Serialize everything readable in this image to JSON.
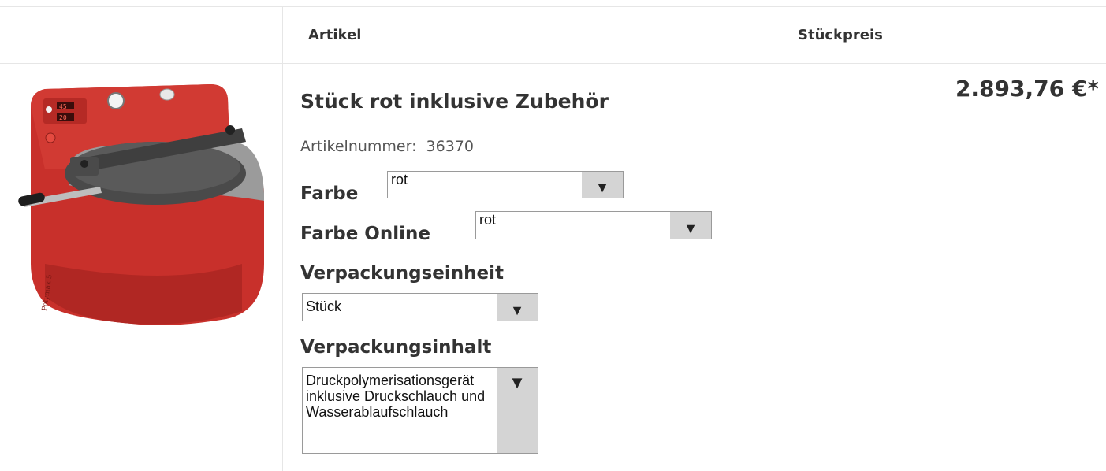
{
  "table": {
    "headers": {
      "article": "Artikel",
      "unit_price": "Stückpreis"
    }
  },
  "product": {
    "title": "Stück rot inklusive Zubehör",
    "article_number_label": "Artikelnummer:",
    "article_number": "36370",
    "price": "2.893,76 €*",
    "image_icon": "polymax-pressure-pot-image",
    "colors": {
      "body_red": "#c8302b",
      "lid_gray": "#4a4a4a"
    }
  },
  "options": {
    "farbe": {
      "label": "Farbe",
      "value": "rot"
    },
    "farbe_online": {
      "label": "Farbe Online",
      "value": "rot"
    },
    "verpackungseinheit": {
      "label": "Verpackungseinheit",
      "value": "Stück"
    },
    "verpackungsinhalt": {
      "label": "Verpackungsinhalt",
      "value": "Druckpolymerisationsgerät inklusive Druckschlauch und Wasserablaufschlauch"
    }
  }
}
